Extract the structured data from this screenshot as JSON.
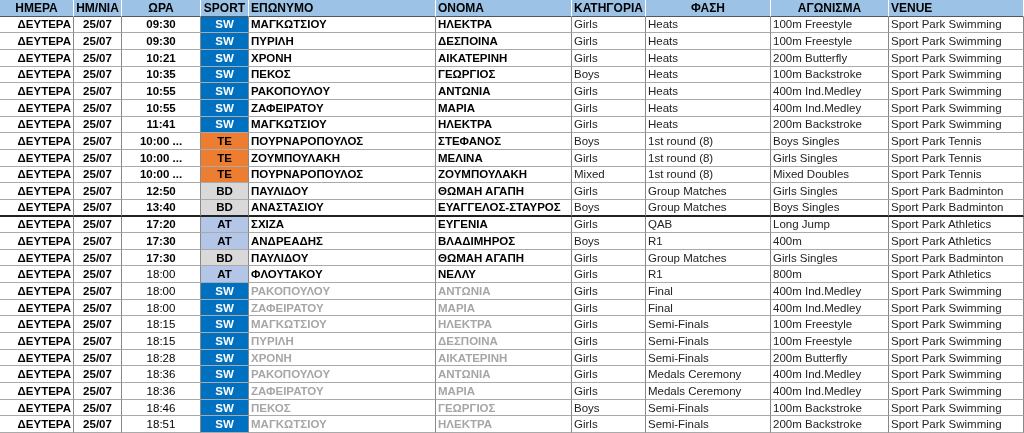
{
  "table": {
    "columns": [
      "ΗΜΕΡΑ",
      "ΗΜ/ΝΙΑ",
      "ΩΡΑ",
      "SPORT",
      "ΕΠΩΝΥΜΟ",
      "ΟΝΟΜΑ",
      "ΚΑΤΗΓΟΡΙΑ",
      "ΦΑΣΗ",
      "ΑΓΩΝΙΣΜΑ",
      "VENUE"
    ],
    "rows": [
      {
        "day": "ΔΕΥΤΕΡΑ",
        "date": "25/07",
        "time": "09:30",
        "time_bold": true,
        "sport": "SW",
        "color": "#0070c0",
        "surname": "ΜΑΓΚΩΤΣΙΟΥ",
        "name": "ΗΛΕΚΤΡΑ",
        "muted": false,
        "category": "Girls",
        "phase": "Heats",
        "event": "100m Freestyle",
        "venue": "Sport Park Swimming",
        "divider_below": false
      },
      {
        "day": "ΔΕΥΤΕΡΑ",
        "date": "25/07",
        "time": "09:30",
        "time_bold": true,
        "sport": "SW",
        "color": "#0070c0",
        "surname": "ΠΥΡΙΛΗ",
        "name": "ΔΕΣΠΟΙΝΑ",
        "muted": false,
        "category": "Girls",
        "phase": "Heats",
        "event": "100m Freestyle",
        "venue": "Sport Park Swimming",
        "divider_below": false
      },
      {
        "day": "ΔΕΥΤΕΡΑ",
        "date": "25/07",
        "time": "10:21",
        "time_bold": true,
        "sport": "SW",
        "color": "#0070c0",
        "surname": "ΧΡΟΝΗ",
        "name": "ΑΙΚΑΤΕΡΙΝΗ",
        "muted": false,
        "category": "Girls",
        "phase": "Heats",
        "event": "200m Butterfly",
        "venue": "Sport Park Swimming",
        "divider_below": false
      },
      {
        "day": "ΔΕΥΤΕΡΑ",
        "date": "25/07",
        "time": "10:35",
        "time_bold": true,
        "sport": "SW",
        "color": "#0070c0",
        "surname": "ΠΕΚΟΣ",
        "name": "ΓΕΩΡΓΙΟΣ",
        "muted": false,
        "category": "Boys",
        "phase": "Heats",
        "event": "100m Backstroke",
        "venue": "Sport Park Swimming",
        "divider_below": false
      },
      {
        "day": "ΔΕΥΤΕΡΑ",
        "date": "25/07",
        "time": "10:55",
        "time_bold": true,
        "sport": "SW",
        "color": "#0070c0",
        "surname": "ΡΑΚΟΠΟΥΛΟΥ",
        "name": "ΑΝΤΩΝΙΑ",
        "muted": false,
        "category": "Girls",
        "phase": "Heats",
        "event": "400m Ind.Medley",
        "venue": "Sport Park Swimming",
        "divider_below": false
      },
      {
        "day": "ΔΕΥΤΕΡΑ",
        "date": "25/07",
        "time": "10:55",
        "time_bold": true,
        "sport": "SW",
        "color": "#0070c0",
        "surname": "ΖΑΦΕΙΡΑΤΟΥ",
        "name": "ΜΑΡΙΑ",
        "muted": false,
        "category": "Girls",
        "phase": "Heats",
        "event": "400m Ind.Medley",
        "venue": "Sport Park Swimming",
        "divider_below": false
      },
      {
        "day": "ΔΕΥΤΕΡΑ",
        "date": "25/07",
        "time": "11:41",
        "time_bold": true,
        "sport": "SW",
        "color": "#0070c0",
        "surname": "ΜΑΓΚΩΤΣΙΟΥ",
        "name": "ΗΛΕΚΤΡΑ",
        "muted": false,
        "category": "Girls",
        "phase": "Heats",
        "event": "200m Backstroke",
        "venue": "Sport Park Swimming",
        "divider_below": false
      },
      {
        "day": "ΔΕΥΤΕΡΑ",
        "date": "25/07",
        "time": "10:00 ...",
        "time_bold": true,
        "sport": "TE",
        "color": "#ed7d31",
        "surname": "ΠΟΥΡΝΑΡΟΠΟΥΛΟΣ",
        "name": "ΣΤΕΦΑΝΟΣ",
        "muted": false,
        "category": "Boys",
        "phase": "1st round (8)",
        "event": "Boys Singles",
        "venue": "Sport Park Tennis",
        "divider_below": false
      },
      {
        "day": "ΔΕΥΤΕΡΑ",
        "date": "25/07",
        "time": "10:00 ...",
        "time_bold": true,
        "sport": "TE",
        "color": "#ed7d31",
        "surname": "ΖΟΥΜΠΟΥΛΑΚΗ",
        "name": "ΜΕΛΙΝΑ",
        "muted": false,
        "category": "Girls",
        "phase": "1st round (8)",
        "event": "Girls Singles",
        "venue": "Sport Park Tennis",
        "divider_below": false
      },
      {
        "day": "ΔΕΥΤΕΡΑ",
        "date": "25/07",
        "time": "10:00 ...",
        "time_bold": true,
        "sport": "TE",
        "color": "#ed7d31",
        "surname": "ΠΟΥΡΝΑΡΟΠΟΥΛΟΣ",
        "name": "ΖΟΥΜΠΟΥΛΑΚΗ",
        "muted": false,
        "category": "Mixed",
        "phase": "1st round (8)",
        "event": "Mixed Doubles",
        "venue": "Sport Park Tennis",
        "divider_below": false
      },
      {
        "day": "ΔΕΥΤΕΡΑ",
        "date": "25/07",
        "time": "12:50",
        "time_bold": true,
        "sport": "BD",
        "color": "#d9d9d9",
        "surname": "ΠΑΥΛΙΔΟΥ",
        "name": "ΘΩΜΑΗ ΑΓΑΠΗ",
        "muted": false,
        "category": "Girls",
        "phase": "Group Matches",
        "event": "Girls Singles",
        "venue": "Sport Park Badminton",
        "divider_below": false
      },
      {
        "day": "ΔΕΥΤΕΡΑ",
        "date": "25/07",
        "time": "13:40",
        "time_bold": true,
        "sport": "BD",
        "color": "#d9d9d9",
        "surname": "ΑΝΑΣΤΑΣΙΟΥ",
        "name": "ΕΥΑΓΓΕΛΟΣ-ΣΤΑΥΡΟΣ",
        "muted": false,
        "category": "Boys",
        "phase": "Group Matches",
        "event": "Boys Singles",
        "venue": "Sport Park Badminton",
        "divider_below": true
      },
      {
        "day": "ΔΕΥΤΕΡΑ",
        "date": "25/07",
        "time": "17:20",
        "time_bold": true,
        "sport": "AT",
        "color": "#b4c6e7",
        "surname": "ΣΧΙΖΑ",
        "name": "ΕΥΓΕΝΙΑ",
        "muted": false,
        "category": "Girls",
        "phase": "QAB",
        "event": "Long Jump",
        "venue": "Sport Park Athletics",
        "divider_below": false
      },
      {
        "day": "ΔΕΥΤΕΡΑ",
        "date": "25/07",
        "time": "17:30",
        "time_bold": true,
        "sport": "AT",
        "color": "#b4c6e7",
        "surname": "ΑΝΔΡΕΑΔΗΣ",
        "name": "ΒΛΑΔΙΜΗΡΟΣ",
        "muted": false,
        "category": "Boys",
        "phase": "R1",
        "event": "400m",
        "venue": "Sport Park Athletics",
        "divider_below": false
      },
      {
        "day": "ΔΕΥΤΕΡΑ",
        "date": "25/07",
        "time": "17:30",
        "time_bold": true,
        "sport": "BD",
        "color": "#d9d9d9",
        "surname": "ΠΑΥΛΙΔΟΥ",
        "name": "ΘΩΜΑΗ ΑΓΑΠΗ",
        "muted": false,
        "category": "Girls",
        "phase": "Group Matches",
        "event": "Girls Singles",
        "venue": "Sport Park Badminton",
        "divider_below": false
      },
      {
        "day": "ΔΕΥΤΕΡΑ",
        "date": "25/07",
        "time": "18:00",
        "time_bold": false,
        "sport": "AT",
        "color": "#b4c6e7",
        "surname": "ΦΛΟΥΤΑΚΟΥ",
        "name": "ΝΕΛΛΥ",
        "muted": false,
        "category": "Girls",
        "phase": "R1",
        "event": "800m",
        "venue": "Sport Park Athletics",
        "divider_below": false
      },
      {
        "day": "ΔΕΥΤΕΡΑ",
        "date": "25/07",
        "time": "18:00",
        "time_bold": false,
        "sport": "SW",
        "color": "#0070c0",
        "surname": "ΡΑΚΟΠΟΥΛΟΥ",
        "name": "ΑΝΤΩΝΙΑ",
        "muted": true,
        "category": "Girls",
        "phase": "Final",
        "event": "400m Ind.Medley",
        "venue": "Sport Park Swimming",
        "divider_below": false
      },
      {
        "day": "ΔΕΥΤΕΡΑ",
        "date": "25/07",
        "time": "18:00",
        "time_bold": false,
        "sport": "SW",
        "color": "#0070c0",
        "surname": "ΖΑΦΕΙΡΑΤΟΥ",
        "name": "ΜΑΡΙΑ",
        "muted": true,
        "category": "Girls",
        "phase": "Final",
        "event": "400m Ind.Medley",
        "venue": "Sport Park Swimming",
        "divider_below": false
      },
      {
        "day": "ΔΕΥΤΕΡΑ",
        "date": "25/07",
        "time": "18:15",
        "time_bold": false,
        "sport": "SW",
        "color": "#0070c0",
        "surname": "ΜΑΓΚΩΤΣΙΟΥ",
        "name": "ΗΛΕΚΤΡΑ",
        "muted": true,
        "category": "Girls",
        "phase": "Semi-Finals",
        "event": "100m Freestyle",
        "venue": "Sport Park Swimming",
        "divider_below": false
      },
      {
        "day": "ΔΕΥΤΕΡΑ",
        "date": "25/07",
        "time": "18:15",
        "time_bold": false,
        "sport": "SW",
        "color": "#0070c0",
        "surname": "ΠΥΡΙΛΗ",
        "name": "ΔΕΣΠΟΙΝΑ",
        "muted": true,
        "category": "Girls",
        "phase": "Semi-Finals",
        "event": "100m Freestyle",
        "venue": "Sport Park Swimming",
        "divider_below": false
      },
      {
        "day": "ΔΕΥΤΕΡΑ",
        "date": "25/07",
        "time": "18:28",
        "time_bold": false,
        "sport": "SW",
        "color": "#0070c0",
        "surname": "ΧΡΟΝΗ",
        "name": "ΑΙΚΑΤΕΡΙΝΗ",
        "muted": true,
        "category": "Girls",
        "phase": "Semi-Finals",
        "event": "200m Butterfly",
        "venue": "Sport Park Swimming",
        "divider_below": false
      },
      {
        "day": "ΔΕΥΤΕΡΑ",
        "date": "25/07",
        "time": "18:36",
        "time_bold": false,
        "sport": "SW",
        "color": "#0070c0",
        "surname": "ΡΑΚΟΠΟΥΛΟΥ",
        "name": "ΑΝΤΩΝΙΑ",
        "muted": true,
        "category": "Girls",
        "phase": "Medals Ceremony",
        "event": "400m Ind.Medley",
        "venue": "Sport Park Swimming",
        "divider_below": false
      },
      {
        "day": "ΔΕΥΤΕΡΑ",
        "date": "25/07",
        "time": "18:36",
        "time_bold": false,
        "sport": "SW",
        "color": "#0070c0",
        "surname": "ΖΑΦΕΙΡΑΤΟΥ",
        "name": "ΜΑΡΙΑ",
        "muted": true,
        "category": "Girls",
        "phase": "Medals Ceremony",
        "event": "400m Ind.Medley",
        "venue": "Sport Park Swimming",
        "divider_below": false
      },
      {
        "day": "ΔΕΥΤΕΡΑ",
        "date": "25/07",
        "time": "18:46",
        "time_bold": false,
        "sport": "SW",
        "color": "#0070c0",
        "surname": "ΠΕΚΟΣ",
        "name": "ΓΕΩΡΓΙΟΣ",
        "muted": true,
        "category": "Boys",
        "phase": "Semi-Finals",
        "event": "100m Backstroke",
        "venue": "Sport Park Swimming",
        "divider_below": false
      },
      {
        "day": "ΔΕΥΤΕΡΑ",
        "date": "25/07",
        "time": "18:51",
        "time_bold": false,
        "sport": "SW",
        "color": "#0070c0",
        "surname": "ΜΑΓΚΩΤΣΙΟΥ",
        "name": "ΗΛΕΚΤΡΑ",
        "muted": true,
        "category": "Girls",
        "phase": "Semi-Finals",
        "event": "200m Backstroke",
        "venue": "Sport Park Swimming",
        "divider_below": false
      }
    ]
  }
}
